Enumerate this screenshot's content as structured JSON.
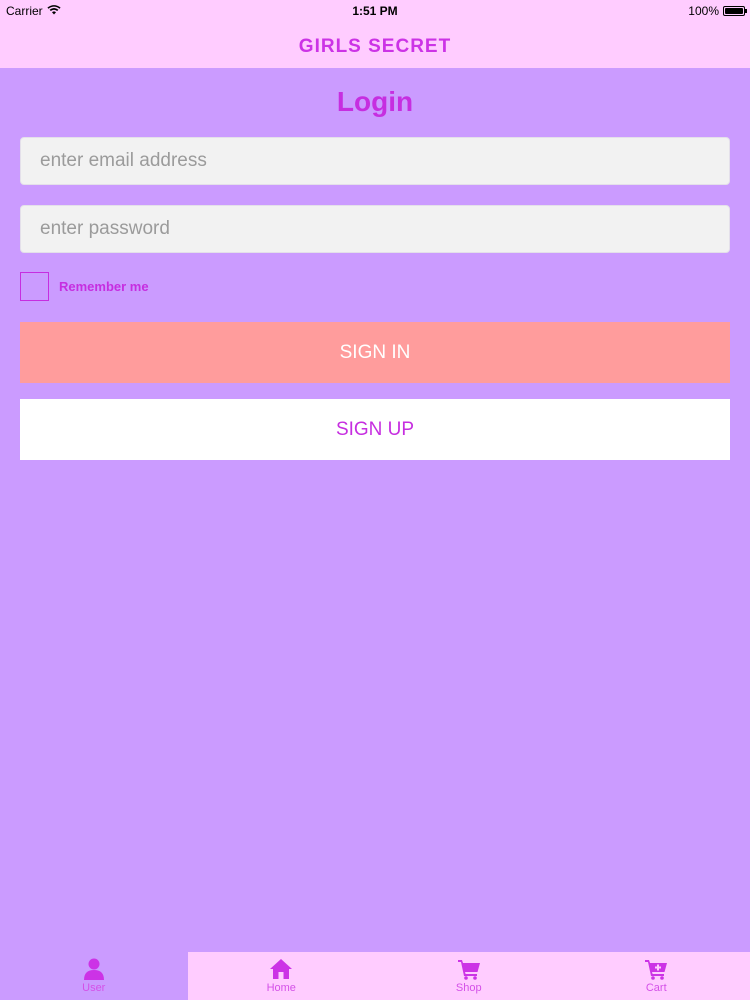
{
  "status_bar": {
    "carrier": "Carrier",
    "time": "1:51 PM",
    "battery": "100%",
    "battery_level": 1.0
  },
  "nav": {
    "title": "GIRLS SECRET"
  },
  "login": {
    "heading": "Login",
    "email_placeholder": "enter email address",
    "email_value": "",
    "password_placeholder": "enter password",
    "password_value": "",
    "remember_label": "Remember me",
    "remember_checked": false,
    "signin_label": "SIGN IN",
    "signup_label": "SIGN UP"
  },
  "tabs": [
    {
      "label": "User",
      "icon": "user-icon",
      "active": true
    },
    {
      "label": "Home",
      "icon": "home-icon",
      "active": false
    },
    {
      "label": "Shop",
      "icon": "cart-icon",
      "active": false
    },
    {
      "label": "Cart",
      "icon": "cart-add-icon",
      "active": false
    }
  ],
  "colors": {
    "background": "#cb9bff",
    "bar": "#ffccff",
    "accent": "#c62ee0",
    "signin_button": "#ff9c9c",
    "signup_button": "#ffffff"
  }
}
